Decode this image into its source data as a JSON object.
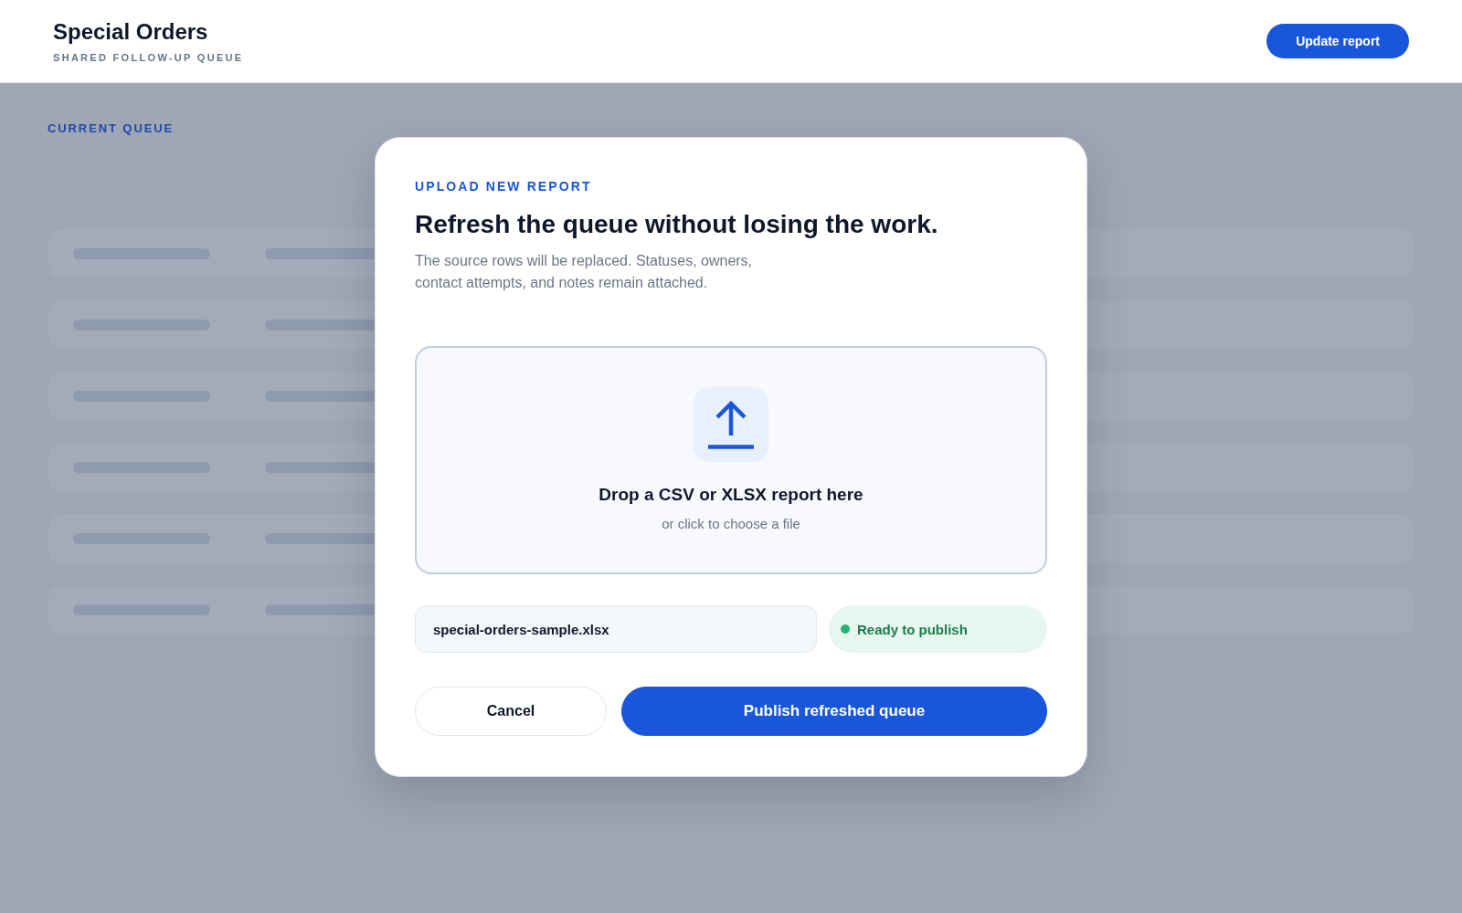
{
  "header": {
    "title": "Special Orders",
    "subtitle": "SHARED FOLLOW-UP QUEUE",
    "action": {
      "label": "Update report"
    }
  },
  "queue": {
    "label": "CURRENT QUEUE",
    "rows": [
      {
        "kind": "skeleton"
      },
      {
        "kind": "skeleton"
      },
      {
        "kind": "skeleton"
      },
      {
        "kind": "skeleton"
      },
      {
        "kind": "skeleton"
      },
      {
        "kind": "skeleton"
      }
    ]
  },
  "dialog": {
    "eyebrow": "UPLOAD NEW REPORT",
    "title": "Refresh the queue without losing the work.",
    "description": "The source rows will be replaced. Statuses, owners, contact attempts, and notes remain attached.",
    "dropzone": {
      "title": "Drop a CSV or XLSX report here",
      "hint": "or click to choose a file"
    },
    "file": {
      "name": "special-orders-sample.xlsx"
    },
    "status": {
      "label": "Ready to publish",
      "ready": true
    },
    "buttons": [
      {
        "label": "Cancel",
        "kind": "secondary"
      },
      {
        "label": "Publish refreshed queue",
        "kind": "primary"
      }
    ]
  }
}
